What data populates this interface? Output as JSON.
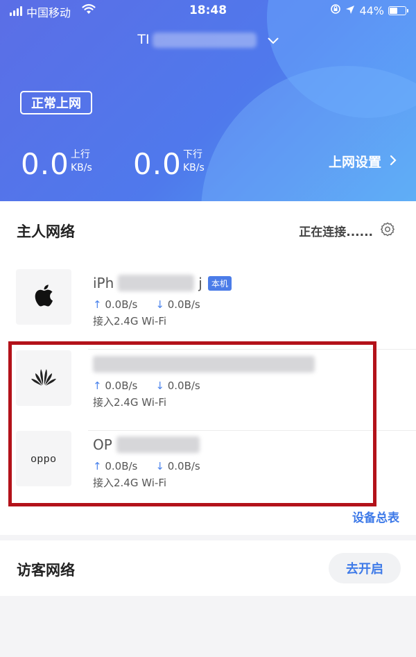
{
  "status_bar": {
    "carrier": "中国移动",
    "time": "18:48",
    "battery": "44%"
  },
  "header": {
    "network_name": "TI",
    "connection_badge": "正常上网",
    "upload": {
      "value": "0.0",
      "label": "上行",
      "unit": "KB/s"
    },
    "download": {
      "value": "0.0",
      "label": "下行",
      "unit": "KB/s"
    },
    "settings_label": "上网设置"
  },
  "host_network": {
    "title": "主人网络",
    "status": "正在连接......",
    "devices": [
      {
        "name": "iPh",
        "name_suffix": "j",
        "tag": "本机",
        "logo": "apple-icon",
        "up": "0.0B/s",
        "down": "0.0B/s",
        "connection": "接入2.4G Wi-Fi"
      },
      {
        "name": "",
        "logo": "huawei-icon",
        "up": "0.0B/s",
        "down": "0.0B/s",
        "connection": "接入2.4G Wi-Fi"
      },
      {
        "name": "OP",
        "logo": "oppo-icon",
        "logo_text": "oppo",
        "up": "0.0B/s",
        "down": "0.0B/s",
        "connection": "接入2.4G Wi-Fi"
      }
    ],
    "device_list_link": "设备总表"
  },
  "guest_network": {
    "title": "访客网络",
    "enable_button": "去开启"
  },
  "colors": {
    "header_gradient_start": "#5b6ee6",
    "header_gradient_end": "#4ea7f2",
    "accent": "#3e7ae8",
    "highlight": "#b3121a"
  }
}
